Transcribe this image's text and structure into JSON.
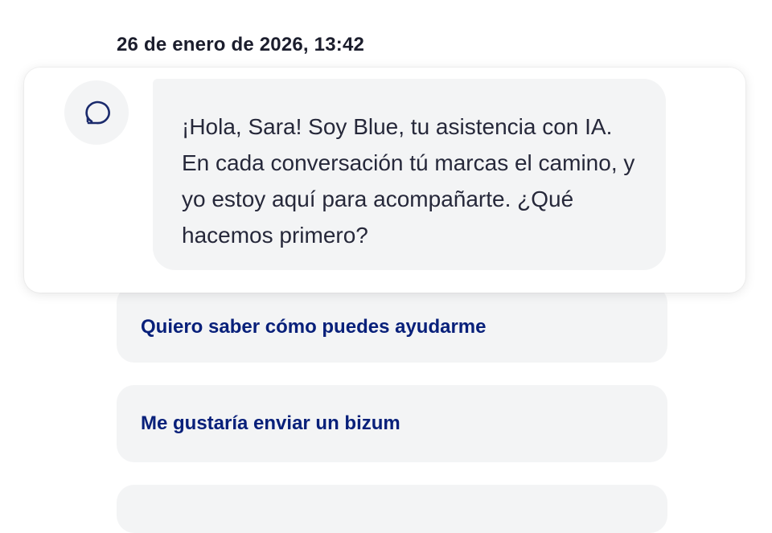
{
  "header": {
    "timestamp": "26 de enero de 2026, 13:42"
  },
  "assistant": {
    "avatar_icon": "chat-bubble-icon",
    "message": "¡Hola, Sara! Soy Blue, tu asistencia con IA. En cada conversación tú marcas el camino, y yo estoy aquí para acompañarte. ¿Qué hacemos primero?"
  },
  "suggestions": [
    {
      "label": "Quiero saber cómo puedes ayudarme"
    },
    {
      "label": "Me gustaría enviar un bizum"
    }
  ],
  "colors": {
    "suggestion_text": "#08207a",
    "bubble_bg": "#f3f4f5",
    "icon": "#1a2a6c"
  }
}
